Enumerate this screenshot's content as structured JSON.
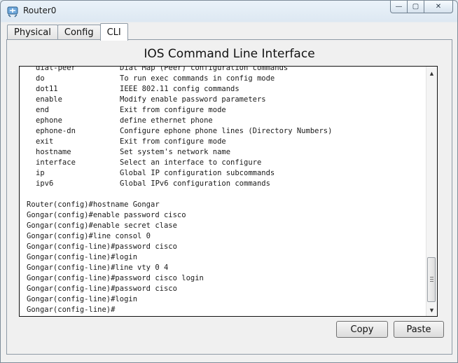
{
  "window": {
    "title": "Router0",
    "controls": {
      "minimize": "—",
      "maximize": "▢",
      "close": "✕"
    }
  },
  "tabs": [
    {
      "label": "Physical",
      "active": false
    },
    {
      "label": "Config",
      "active": false
    },
    {
      "label": "CLI",
      "active": true
    }
  ],
  "cli": {
    "header": "IOS Command Line Interface",
    "help_rows": [
      {
        "cmd": "dial-peer",
        "desc": "Dial Map (Peer) configuration commands"
      },
      {
        "cmd": "do",
        "desc": "To run exec commands in config mode"
      },
      {
        "cmd": "dot11",
        "desc": "IEEE 802.11 config commands"
      },
      {
        "cmd": "enable",
        "desc": "Modify enable password parameters"
      },
      {
        "cmd": "end",
        "desc": "Exit from configure mode"
      },
      {
        "cmd": "ephone",
        "desc": "define ethernet phone"
      },
      {
        "cmd": "ephone-dn",
        "desc": "Configure ephone phone lines (Directory Numbers)"
      },
      {
        "cmd": "exit",
        "desc": "Exit from configure mode"
      },
      {
        "cmd": "hostname",
        "desc": "Set system's network name"
      },
      {
        "cmd": "interface",
        "desc": "Select an interface to configure"
      },
      {
        "cmd": "ip",
        "desc": "Global IP configuration subcommands"
      },
      {
        "cmd": "ipv6",
        "desc": "Global IPv6 configuration commands"
      }
    ],
    "session_lines": [
      "Router(config)#hostname Gongar",
      "Gongar(config)#enable password cisco",
      "Gongar(config)#enable secret clase",
      "Gongar(config)#line consol 0",
      "Gongar(config-line)#password cisco",
      "Gongar(config-line)#login",
      "Gongar(config-line)#line vty 0 4",
      "Gongar(config-line)#password cisco login",
      "Gongar(config-line)#password cisco",
      "Gongar(config-line)#login",
      "Gongar(config-line)#"
    ]
  },
  "buttons": {
    "copy": "Copy",
    "paste": "Paste"
  }
}
